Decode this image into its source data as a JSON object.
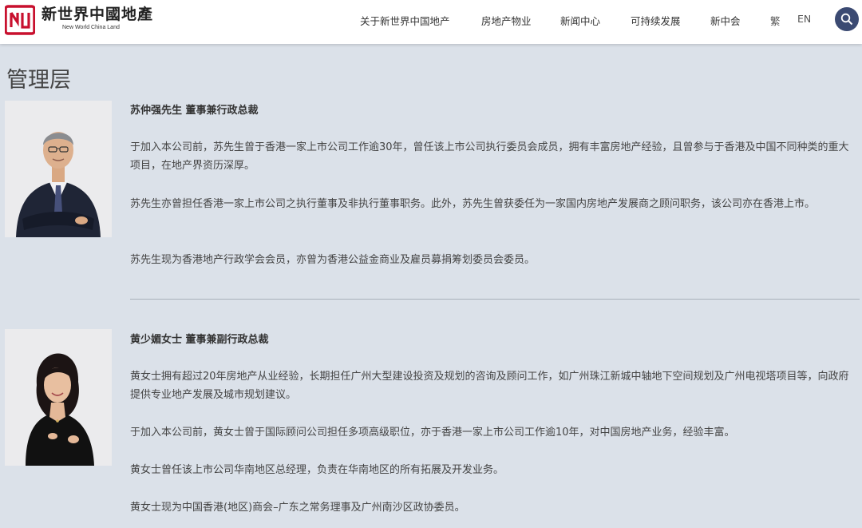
{
  "header": {
    "logo_cn": "新世界中國地產",
    "logo_en": "New World China Land",
    "nav": [
      {
        "label": "关于新世界中国地产"
      },
      {
        "label": "房地产物业"
      },
      {
        "label": "新闻中心"
      },
      {
        "label": "可持续发展"
      },
      {
        "label": "新中会"
      }
    ],
    "lang_trad": "繁",
    "lang_en": "EN",
    "brand_color": "#c8102e",
    "search_color": "#3b4a72"
  },
  "page": {
    "title": "管理层"
  },
  "profiles": [
    {
      "name": "苏仲强先生 董事兼行政总裁",
      "paragraphs": [
        "于加入本公司前，苏先生曾于香港一家上市公司工作逾30年，曾任该上市公司执行委员会成员，拥有丰富房地产经验，且曾参与于香港及中国不同种类的重大项目，在地产界资历深厚。",
        "苏先生亦曾担任香港一家上市公司之执行董事及非执行董事职务。此外，苏先生曾获委任为一家国内房地产发展商之顾问职务，该公司亦在香港上市。",
        "苏先生现为香港地产行政学会会员，亦曾为香港公益金商业及雇员募捐筹划委员会委员。"
      ]
    },
    {
      "name": "黄少媚女士 董事兼副行政总裁",
      "paragraphs": [
        "黄女士拥有超过20年房地产从业经验，长期担任广州大型建设投资及规划的咨询及顾问工作，如广州珠江新城中轴地下空间规划及广州电视塔项目等，向政府提供专业地产发展及城市规划建议。",
        "于加入本公司前，黄女士曾于国际顾问公司担任多项高级职位，亦于香港一家上市公司工作逾10年，对中国房地产业务，经验丰富。",
        "黄女士曾任该上市公司华南地区总经理，负责在华南地区的所有拓展及开发业务。",
        "黄女士现为中国香港(地区)商会–广东之常务理事及广州南沙区政协委员。"
      ]
    }
  ]
}
